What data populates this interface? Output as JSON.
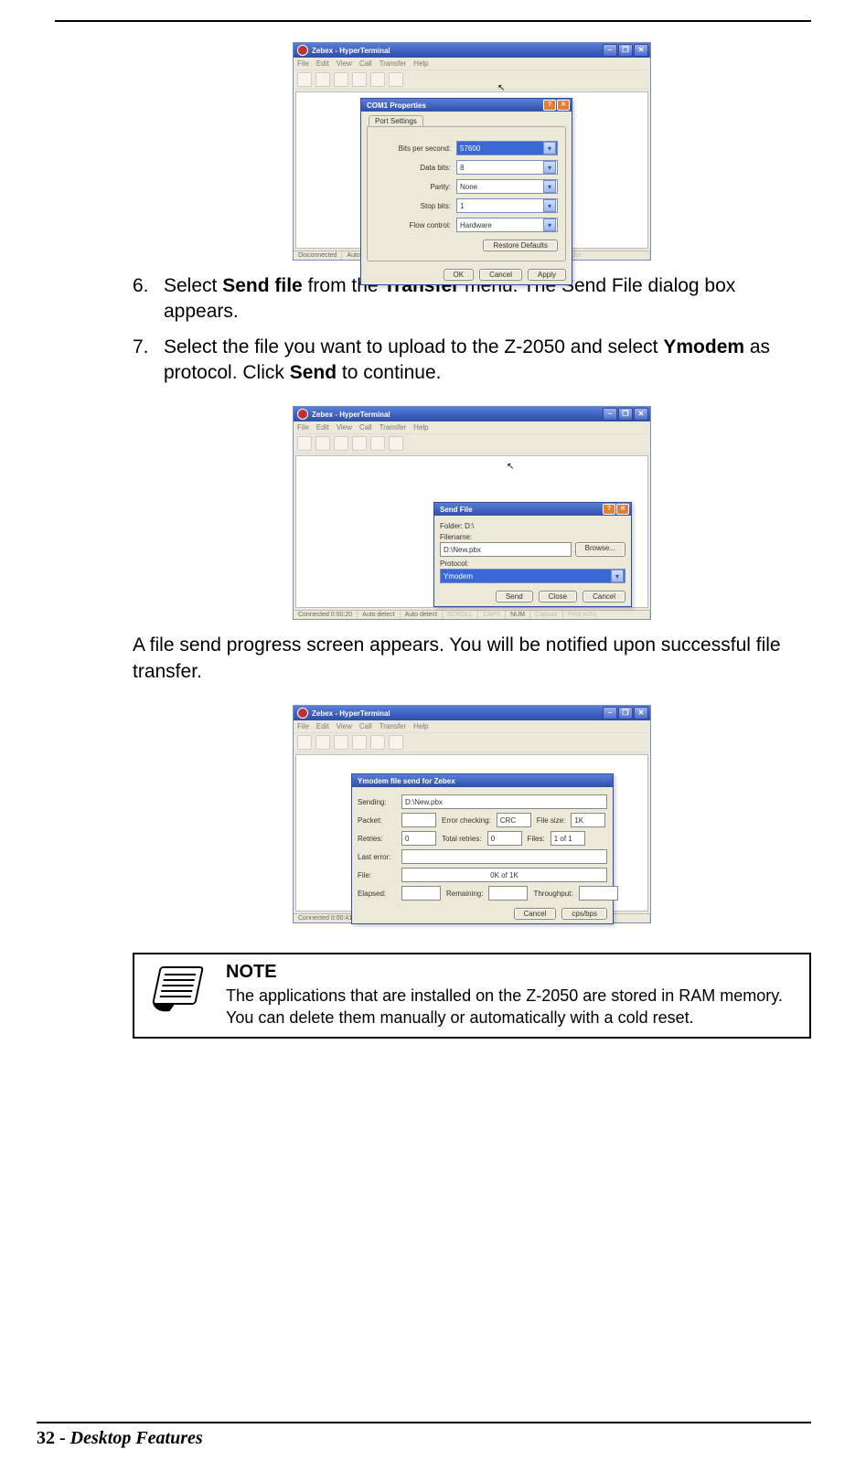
{
  "steps": [
    {
      "num": "6.",
      "parts": [
        "Select ",
        "Send file",
        " from the ",
        "Transfer",
        " menu. The Send File dialog box appears."
      ]
    },
    {
      "num": "7.",
      "parts": [
        "Select the file you want to upload to the Z-2050 and select ",
        "Ymodem",
        " as protocol. Click ",
        "Send",
        " to continue."
      ]
    }
  ],
  "paragraph_after_fig2": "A file send progress screen appears. You will be notified upon successful file transfer.",
  "note": {
    "heading": "NOTE",
    "body": "The applications that are installed on the Z-2050 are stored in RAM memory. You can delete them manually or automatically with a cold reset."
  },
  "footer": {
    "page": "32",
    "sep": "  -  ",
    "section": "Desktop Features"
  },
  "ht_common": {
    "title": "Zebex - HyperTerminal",
    "menu": [
      "File",
      "Edit",
      "View",
      "Call",
      "Transfer",
      "Help"
    ],
    "win_btns": [
      "–",
      "❐",
      "✕"
    ]
  },
  "status": {
    "disconnected": "Disconnected",
    "conn1": "Connected 0:00:20",
    "conn2": "Connected 0:00:41",
    "autodetect": "Auto detect",
    "scroll": "SCROLL",
    "caps": "CAPS",
    "num": "NUM",
    "capture": "Capture",
    "printecho": "Print echo"
  },
  "fig1": {
    "dialog_title": "COM1 Properties",
    "tab": "Port Settings",
    "rows": {
      "bps_label": "Bits per second:",
      "bps_value": "57600",
      "data_label": "Data bits:",
      "data_value": "8",
      "parity_label": "Parity:",
      "parity_value": "None",
      "stop_label": "Stop bits:",
      "stop_value": "1",
      "flow_label": "Flow control:",
      "flow_value": "Hardware"
    },
    "restore": "Restore Defaults",
    "ok": "OK",
    "cancel": "Cancel",
    "apply": "Apply"
  },
  "fig2": {
    "dialog_title": "Send File",
    "folder_label": "Folder: D:\\",
    "filename_label": "Filename:",
    "filename_value": "D:\\New.pbx",
    "browse": "Browse...",
    "protocol_label": "Protocol:",
    "protocol_value": "Ymodem",
    "send": "Send",
    "close": "Close",
    "cancel": "Cancel"
  },
  "fig3": {
    "dialog_title": "Ymodem file send for Zebex",
    "sending_label": "Sending:",
    "sending_value": "D:\\New.pbx",
    "packet_label": "Packet:",
    "errchk_label": "Error checking:",
    "errchk_value": "CRC",
    "filesize_label": "File size:",
    "filesize_value": "1K",
    "retries_label": "Retries:",
    "retries_value": "0",
    "totret_label": "Total retries:",
    "totret_value": "0",
    "files_label": "Files:",
    "files_value": "1 of 1",
    "lasterr_label": "Last error:",
    "file_label": "File:",
    "file_progress": "0K of 1K",
    "elapsed_label": "Elapsed:",
    "remaining_label": "Remaining:",
    "throughput_label": "Throughput:",
    "cancel": "Cancel",
    "cpsbps": "cps/bps"
  }
}
